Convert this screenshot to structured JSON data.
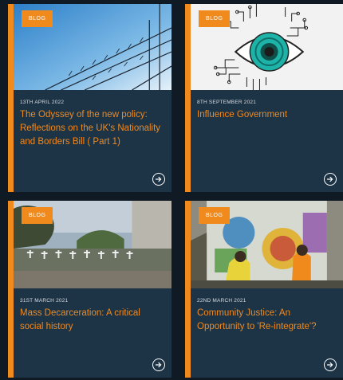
{
  "cards": [
    {
      "badge": "BLOG",
      "date": "13TH APRIL 2022",
      "title": "The Odyssey of the new policy: Reflections on the UK's Nationality and Borders Bill ( Part 1)"
    },
    {
      "badge": "BLOG",
      "date": "8TH SEPTEMBER 2021",
      "title": "Influence Government"
    },
    {
      "badge": "BLOG",
      "date": "31ST MARCH 2021",
      "title": "Mass Decarceration: A critical social history"
    },
    {
      "badge": "BLOG",
      "date": "22ND MARCH 2021",
      "title": "Community Justice: An Opportunity to 'Re-integrate'?"
    }
  ],
  "icons": {
    "arrow": "arrow-right-circle-icon"
  },
  "colors": {
    "accent": "#f08a1d",
    "card": "#1d3346",
    "background": "#0f1a24"
  }
}
